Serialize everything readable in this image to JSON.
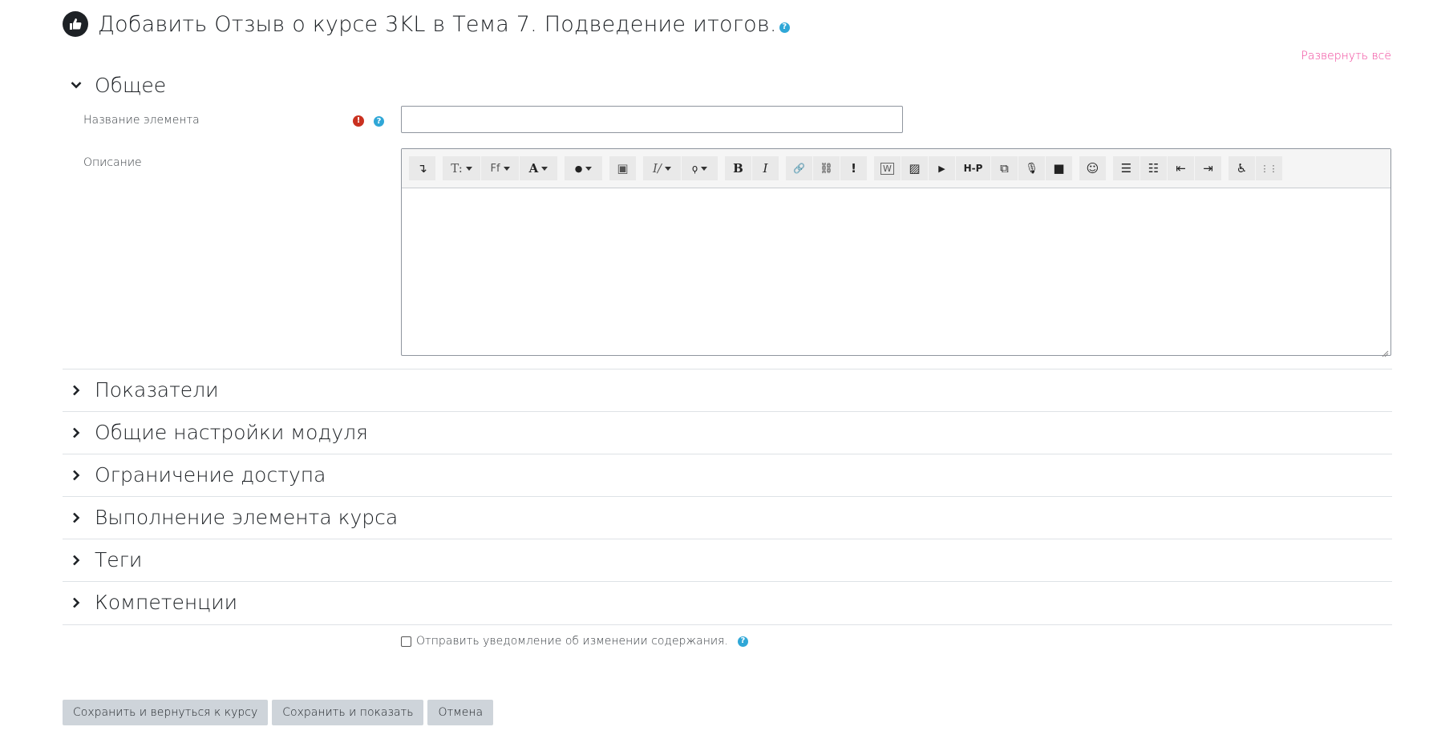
{
  "header": {
    "title": "Добавить Отзыв о курсе 3KL в Тема 7. Подведение итогов.",
    "help_glyph": "?"
  },
  "expand_all_label": "Развернуть всё",
  "general": {
    "title": "Общее",
    "name_label": "Название элемента",
    "name_value": "",
    "required_glyph": "!",
    "help_glyph": "?",
    "description_label": "Описание"
  },
  "toolbar": {
    "buttons": [
      {
        "icon": "collapse-toggle-icon",
        "glyph": "↴"
      },
      {
        "icon": "font-size-icon",
        "glyph": "T:"
      },
      {
        "icon": "font-family-icon",
        "glyph": "Ff"
      },
      {
        "icon": "font-color-icon",
        "glyph": "A"
      },
      {
        "icon": "background-color-icon",
        "glyph": "●"
      },
      {
        "icon": "block-icon",
        "glyph": "▣"
      },
      {
        "icon": "style-icon",
        "glyph": "I/"
      },
      {
        "icon": "wiris-icon",
        "glyph": "ϙ"
      },
      {
        "icon": "bold-icon",
        "glyph": "B"
      },
      {
        "icon": "italic-icon",
        "glyph": "I"
      },
      {
        "icon": "link-icon",
        "glyph": "🔗"
      },
      {
        "icon": "unlink-icon",
        "glyph": "⛓"
      },
      {
        "icon": "important-icon",
        "glyph": "!"
      },
      {
        "icon": "word-import-icon",
        "glyph": "W"
      },
      {
        "icon": "image-icon",
        "glyph": "▨"
      },
      {
        "icon": "media-icon",
        "glyph": "▶"
      },
      {
        "icon": "h5p-icon",
        "glyph": "H-P"
      },
      {
        "icon": "manage-files-icon",
        "glyph": "⧉"
      },
      {
        "icon": "record-audio-icon",
        "glyph": "🎙"
      },
      {
        "icon": "record-video-icon",
        "glyph": "■"
      },
      {
        "icon": "emoji-icon",
        "glyph": "☺"
      },
      {
        "icon": "unordered-list-icon",
        "glyph": "☰"
      },
      {
        "icon": "ordered-list-icon",
        "glyph": "☷"
      },
      {
        "icon": "outdent-icon",
        "glyph": "⇤"
      },
      {
        "icon": "indent-icon",
        "glyph": "⇥"
      },
      {
        "icon": "accessibility-icon",
        "glyph": "♿"
      },
      {
        "icon": "screenreader-icon",
        "glyph": "⋮⋮"
      }
    ]
  },
  "sections": [
    {
      "title": "Показатели"
    },
    {
      "title": "Общие настройки модуля"
    },
    {
      "title": "Ограничение доступа"
    },
    {
      "title": "Выполнение элемента курса"
    },
    {
      "title": "Теги"
    },
    {
      "title": "Компетенции"
    }
  ],
  "notify": {
    "label": "Отправить уведомление об изменении содержания.",
    "checked": false
  },
  "buttons": {
    "save_return": "Сохранить и вернуться к курсу",
    "save_display": "Сохранить и показать",
    "cancel": "Отмена"
  },
  "colors": {
    "accent_link": "#f0439a",
    "help": "#2fa7d7",
    "required": "#ca3120"
  }
}
